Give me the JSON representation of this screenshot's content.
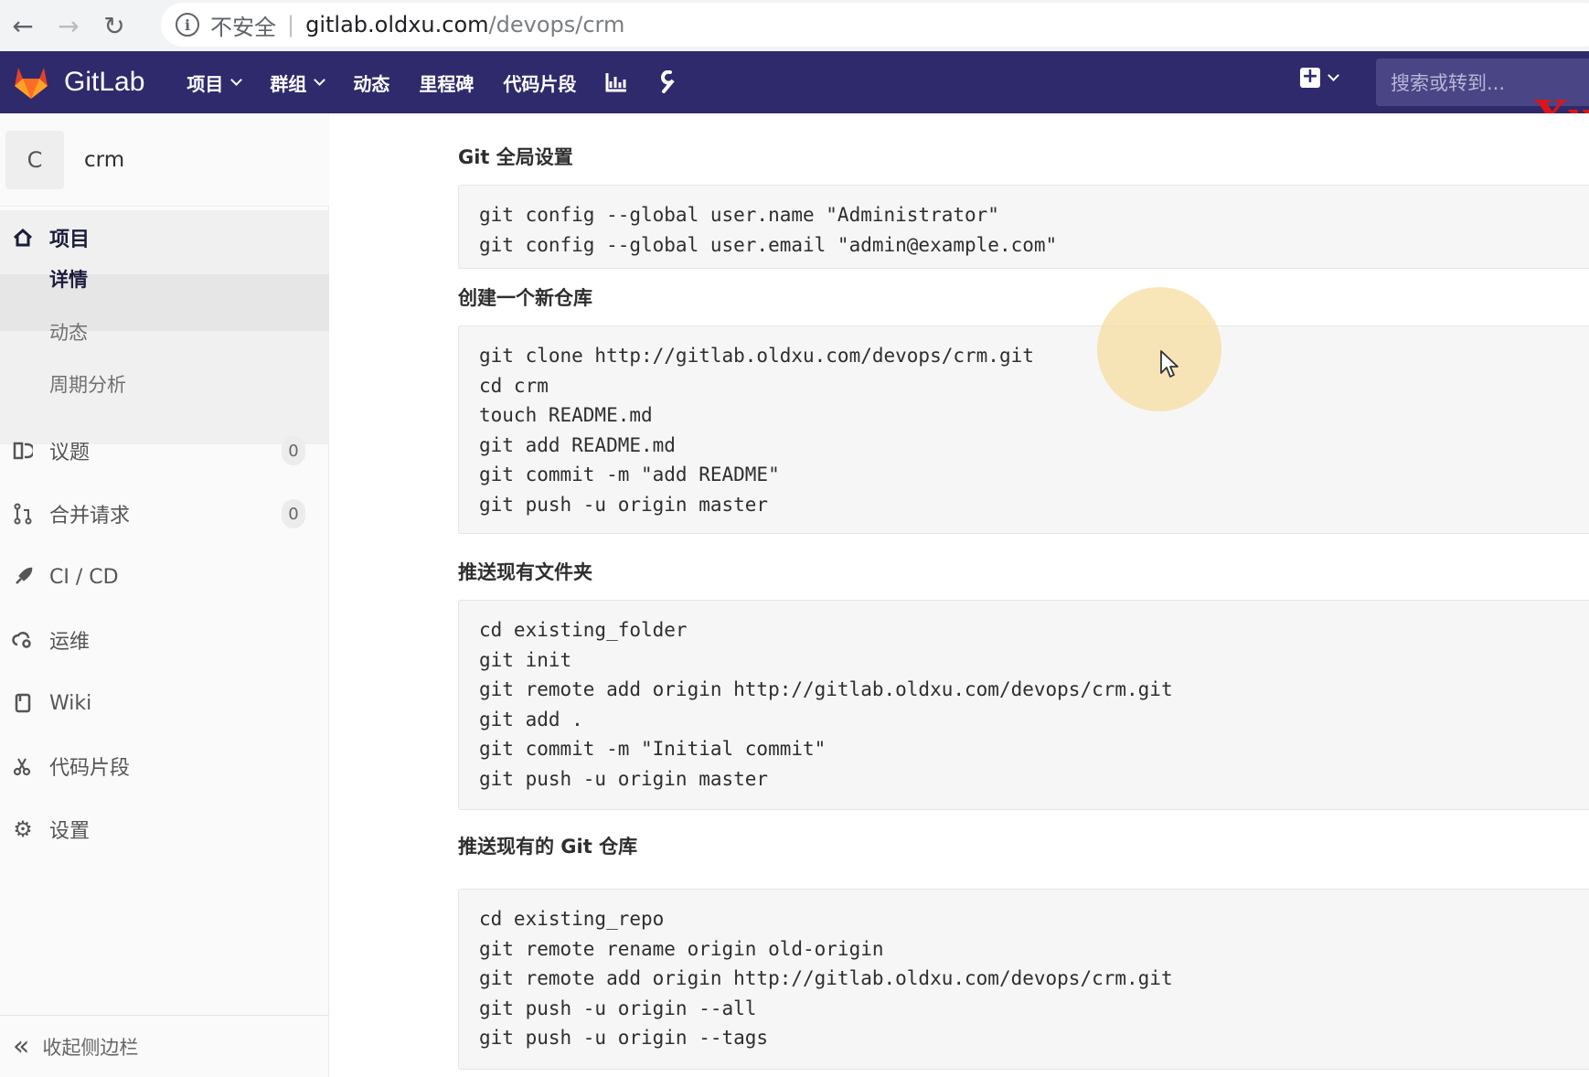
{
  "browser": {
    "security_label": "不安全",
    "url_host": "gitlab.oldxu.com",
    "url_path": "/devops/crm"
  },
  "header": {
    "brand": "GitLab",
    "nav": [
      "项目",
      "群组",
      "动态",
      "里程碑",
      "代码片段"
    ],
    "search_placeholder": "搜索或转到...",
    "watermark": "Xu"
  },
  "sidebar": {
    "project_avatar": "C",
    "project_name": "crm",
    "section_label": "项目",
    "sub_items": [
      "详情",
      "动态",
      "周期分析"
    ],
    "issues_label": "议题",
    "issues_count": "0",
    "merge_label": "合并请求",
    "merge_count": "0",
    "cicd_label": "CI / CD",
    "ops_label": "运维",
    "wiki_label": "Wiki",
    "snippets_label": "代码片段",
    "settings_label": "设置",
    "collapse_label": "收起侧边栏"
  },
  "sections": [
    {
      "title": "Git 全局设置",
      "lines": [
        "git config --global user.name \"Administrator\"",
        "git config --global user.email \"admin@example.com\""
      ]
    },
    {
      "title": "创建一个新仓库",
      "lines": [
        "git clone http://gitlab.oldxu.com/devops/crm.git",
        "cd crm",
        "touch README.md",
        "git add README.md",
        "git commit -m \"add README\"",
        "git push -u origin master"
      ]
    },
    {
      "title": "推送现有文件夹",
      "lines": [
        "cd existing_folder",
        "git init",
        "git remote add origin http://gitlab.oldxu.com/devops/crm.git",
        "git add .",
        "git commit -m \"Initial commit\"",
        "git push -u origin master"
      ]
    },
    {
      "title": "推送现有的 Git 仓库",
      "lines": [
        "cd existing_repo",
        "git remote rename origin old-origin",
        "git remote add origin http://gitlab.oldxu.com/devops/crm.git",
        "git push -u origin --all",
        "git push -u origin --tags"
      ]
    }
  ]
}
